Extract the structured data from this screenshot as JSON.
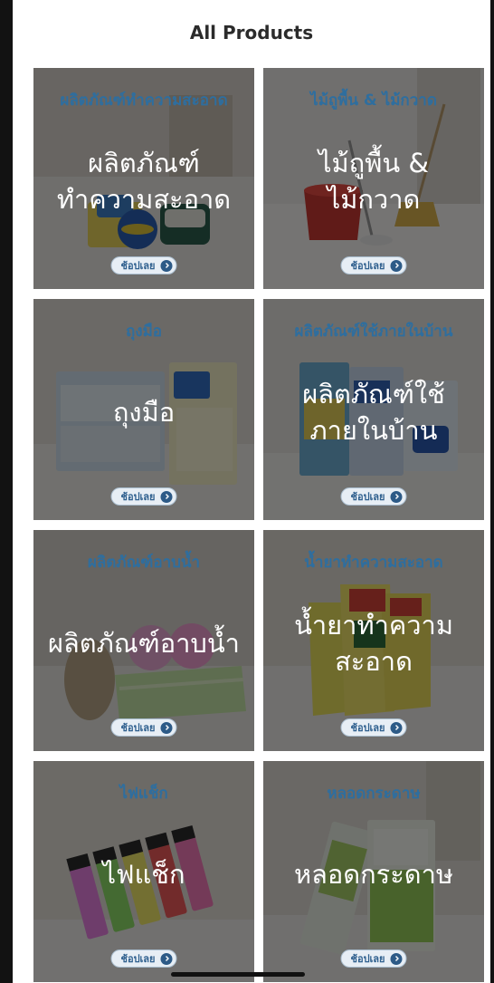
{
  "header": {
    "title": "All Products"
  },
  "products": [
    {
      "title": "ผลิตภัณฑ์ทำความสะอาด",
      "overlay": "ผลิตภัณฑ์\nทำความสะอาด",
      "button": "ช้อปเลย"
    },
    {
      "title": "ไม้ถูพื้น & ไม้กวาด",
      "overlay": "ไม้ถูพื้น &\nไม้กวาด",
      "button": "ช้อปเลย"
    },
    {
      "title": "ถุงมือ",
      "overlay": "ถุงมือ",
      "button": "ช้อปเลย"
    },
    {
      "title": "ผลิตภัณฑ์ใช้ภายในบ้าน",
      "overlay": "ผลิตภัณฑ์ใช้\nภายในบ้าน",
      "button": "ช้อปเลย"
    },
    {
      "title": "ผลิตภัณฑ์อาบน้ำ",
      "overlay": "ผลิตภัณฑ์อาบน้ำ",
      "button": "ช้อปเลย"
    },
    {
      "title": "น้ำยาทำความสะอาด",
      "overlay": "น้ำยาทำความ\nสะอาด",
      "button": "ช้อปเลย"
    },
    {
      "title": "ไฟแช็ก",
      "overlay": "ไฟแช็ก",
      "button": "ช้อปเลย"
    },
    {
      "title": "หลอดกระดาษ",
      "overlay": "หลอดกระดาษ",
      "button": "ช้อปเลย"
    }
  ],
  "colors": {
    "category_title": "#2e6e9f",
    "button_bg": "#e7eef5",
    "button_text": "#2e5f8e",
    "arrow_bg": "#2c5a87"
  },
  "icons": {
    "button_arrow": "chevron-right-circle-icon"
  }
}
